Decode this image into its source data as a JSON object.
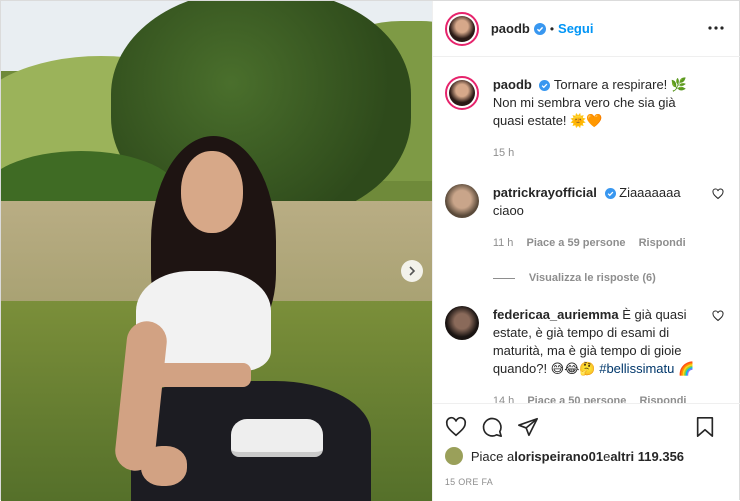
{
  "post": {
    "username": "paodb",
    "follow_label": "Segui",
    "dot": "•",
    "caption_line1": "Tornare a respirare! 🌿",
    "caption_line2": "Non mi sembra vero che sia già quasi estate! 🌞🧡",
    "caption_time": "15 h"
  },
  "comments": [
    {
      "username": "patrickrayofficial",
      "text": "Ziaaaaaaa ciaoo",
      "time": "11 h",
      "likes": "Piace a 59 persone",
      "reply": "Rispondi",
      "view_replies": "Visualizza le risposte (6)"
    },
    {
      "username": "federicaa_auriemma",
      "text": "È già quasi estate, è già tempo di esami di maturità, ma è già tempo di gioie quando?! 😅😂🤔",
      "hashtag": "#bellissimatu",
      "emoji_tail": "🌈",
      "time": "14 h",
      "likes": "Piace a 50 persone",
      "reply": "Rispondi"
    }
  ],
  "likes": {
    "prefix": "Piace a ",
    "user": "lorispeirano01",
    "middle": " e ",
    "others": "altri 119.356"
  },
  "timestamp": "15 ORE FA",
  "colors": {
    "accent": "#0095f6",
    "verified": "#3897f0",
    "text": "#262626",
    "muted": "#8e8e8e"
  },
  "icons": [
    "more-icon",
    "next-arrow-icon",
    "heart-icon",
    "comment-icon",
    "share-icon",
    "bookmark-icon",
    "verified-icon"
  ]
}
